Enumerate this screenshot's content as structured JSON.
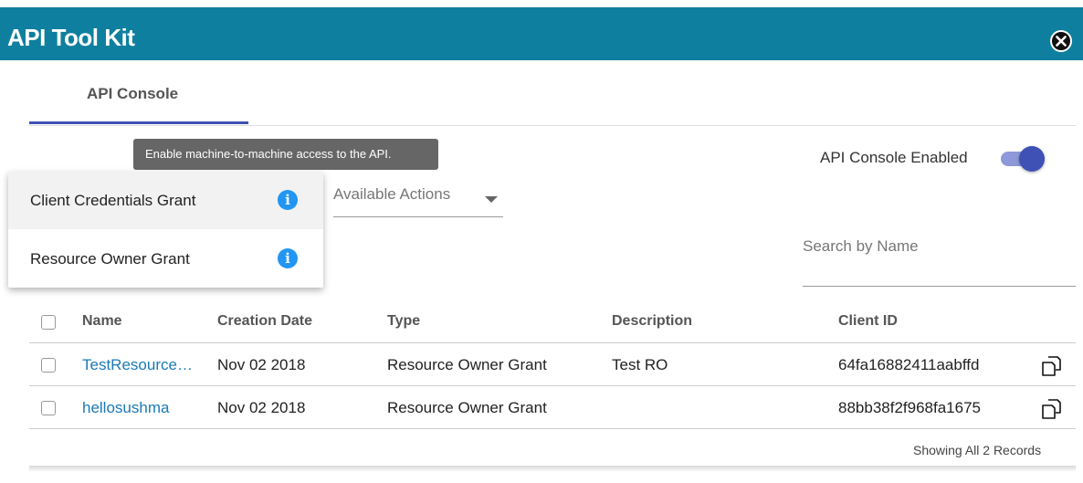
{
  "header": {
    "title": "API Tool Kit"
  },
  "tabs": [
    {
      "label": "API Console",
      "active": true
    }
  ],
  "tooltip": {
    "text": "Enable machine-to-machine access to the API."
  },
  "console_toggle": {
    "label": "API Console Enabled",
    "enabled": true
  },
  "actions": {
    "label": "Available Actions"
  },
  "search": {
    "placeholder": "Search by Name"
  },
  "menu": {
    "items": [
      {
        "label": "Client Credentials Grant",
        "active": true
      },
      {
        "label": "Resource Owner Grant",
        "active": false
      }
    ]
  },
  "table": {
    "columns": [
      "Name",
      "Creation Date",
      "Type",
      "Description",
      "Client ID"
    ],
    "rows": [
      {
        "name": "TestResourceOwner",
        "creation_date": "Nov 02 2018",
        "type": "Resource Owner Grant",
        "description": "Test RO",
        "client_id": "64fa16882411aabffd"
      },
      {
        "name": "hellosushma",
        "creation_date": "Nov 02 2018",
        "type": "Resource Owner Grant",
        "description": "",
        "client_id": "88bb38f2f968fa1675"
      }
    ],
    "footer": "Showing All 2 Records"
  },
  "colors": {
    "header": "#0f7f9f",
    "accent": "#3f51b5",
    "link": "#1a7ab8",
    "info": "#2196f3"
  }
}
